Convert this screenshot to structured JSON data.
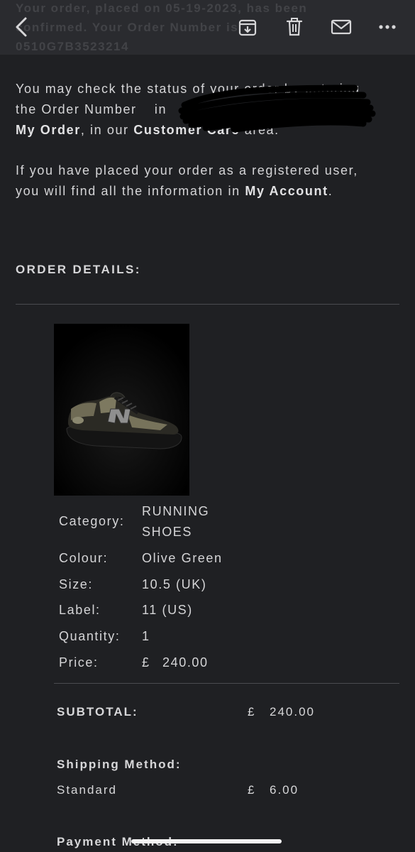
{
  "header": {
    "ghost_line1": "Your order, placed on 05-19-2023, has been",
    "ghost_line2": "confirmed. Your Order Number is",
    "ghost_line3": "0510G7B3523214"
  },
  "intro": {
    "p1_a": "You may check the status of your order by entering the Order Number",
    "p1_b": "in",
    "p1_my_order": "My Order",
    "p1_c": ", in our",
    "p1_customer_care": "Customer Care",
    "p1_d": "area.",
    "p2_a": "If you have placed your order as a registered user, you will find all the information in",
    "p2_my_account": "My Account",
    "p2_b": "."
  },
  "order_details_title": "ORDER DETAILS:",
  "product": {
    "category_label": "Category:",
    "category_line1": "RUNNING",
    "category_line2": "SHOES",
    "colour_label": "Colour:",
    "colour": "Olive Green",
    "size_label": "Size:",
    "size": "10.5 (UK)",
    "label_label": "Label:",
    "label": "11 (US)",
    "quantity_label": "Quantity:",
    "quantity": "1",
    "price_label": "Price:",
    "price_currency": "£",
    "price": "240.00"
  },
  "summary": {
    "subtotal_label": "SUBTOTAL:",
    "subtotal_currency": "£",
    "subtotal": "240.00",
    "shipping_method_label": "Shipping Method:",
    "shipping_method": "Standard",
    "shipping_currency": "£",
    "shipping_cost": "6.00",
    "payment_method_label": "Payment Method:"
  },
  "colors": {
    "background": "#1f2023",
    "toolbar": "#2a2b2f",
    "text": "#d9d9db"
  }
}
